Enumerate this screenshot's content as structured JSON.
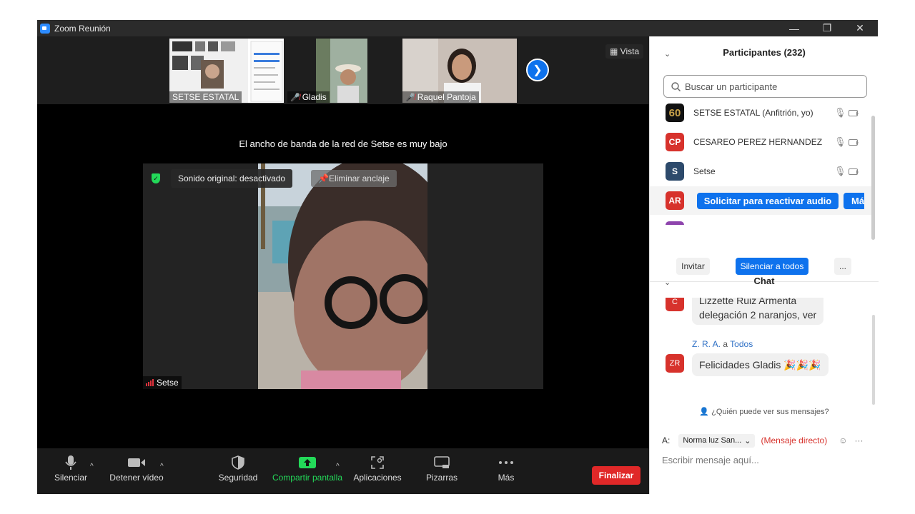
{
  "window": {
    "title": "Zoom Reunión",
    "minimize": "—",
    "restore": "❐",
    "close": "✕"
  },
  "gallery": {
    "tiles": [
      {
        "name": "SETSE ESTATAL",
        "muted": false
      },
      {
        "name": "Gladis",
        "muted": true
      },
      {
        "name": "Raquel Pantoja",
        "muted": true
      }
    ],
    "view_label": "Vista"
  },
  "stage": {
    "bandwidth_notice": "El ancho de banda de la red de Setse es muy bajo",
    "original_sound": "Sonido original: desactivado",
    "unpin": "Eliminar anclaje",
    "speaker": "Setse"
  },
  "toolbar": {
    "mute": "Silenciar",
    "stop_video": "Detener vídeo",
    "security": "Seguridad",
    "share_screen": "Compartir pantalla",
    "apps": "Aplicaciones",
    "whiteboards": "Pizarras",
    "more": "Más",
    "end": "Finalizar"
  },
  "participants": {
    "title": "Participantes (232)",
    "search_placeholder": "Buscar un participante",
    "list": [
      {
        "initials": "60",
        "name": "SETSE ESTATAL (Anfitrión, yo)",
        "color": "#111111"
      },
      {
        "initials": "CP",
        "name": "CESAREO PEREZ HERNANDEZ",
        "color": "#d7322c"
      },
      {
        "initials": "S",
        "name": "Setse",
        "color": "#2d4a6b"
      },
      {
        "initials": "AR",
        "name": "",
        "color": "#d7322c"
      }
    ],
    "ask_unmute": "Solicitar para reactivar audio",
    "more_btn": "Má",
    "invite": "Invitar",
    "mute_all": "Silenciar a todos",
    "ellipsis": "..."
  },
  "chat": {
    "title": "Chat",
    "messages": [
      {
        "avatar": "C",
        "sender": "",
        "text_lines": [
          "Lizzette Ruiz Armenta",
          "delegación 2 naranjos, ver"
        ]
      },
      {
        "avatar": "ZR",
        "sender": "Z. R. A.",
        "to_word": "a",
        "recipient": "Todos",
        "text": "Felicidades Gladis 🎉🎉🎉"
      }
    ],
    "who_sees": "¿Quién puede ver sus mensajes?",
    "to_label": "A:",
    "to_value": "Norma luz San...",
    "direct": "(Mensaje directo)",
    "input_placeholder": "Escribir mensaje aquí..."
  }
}
